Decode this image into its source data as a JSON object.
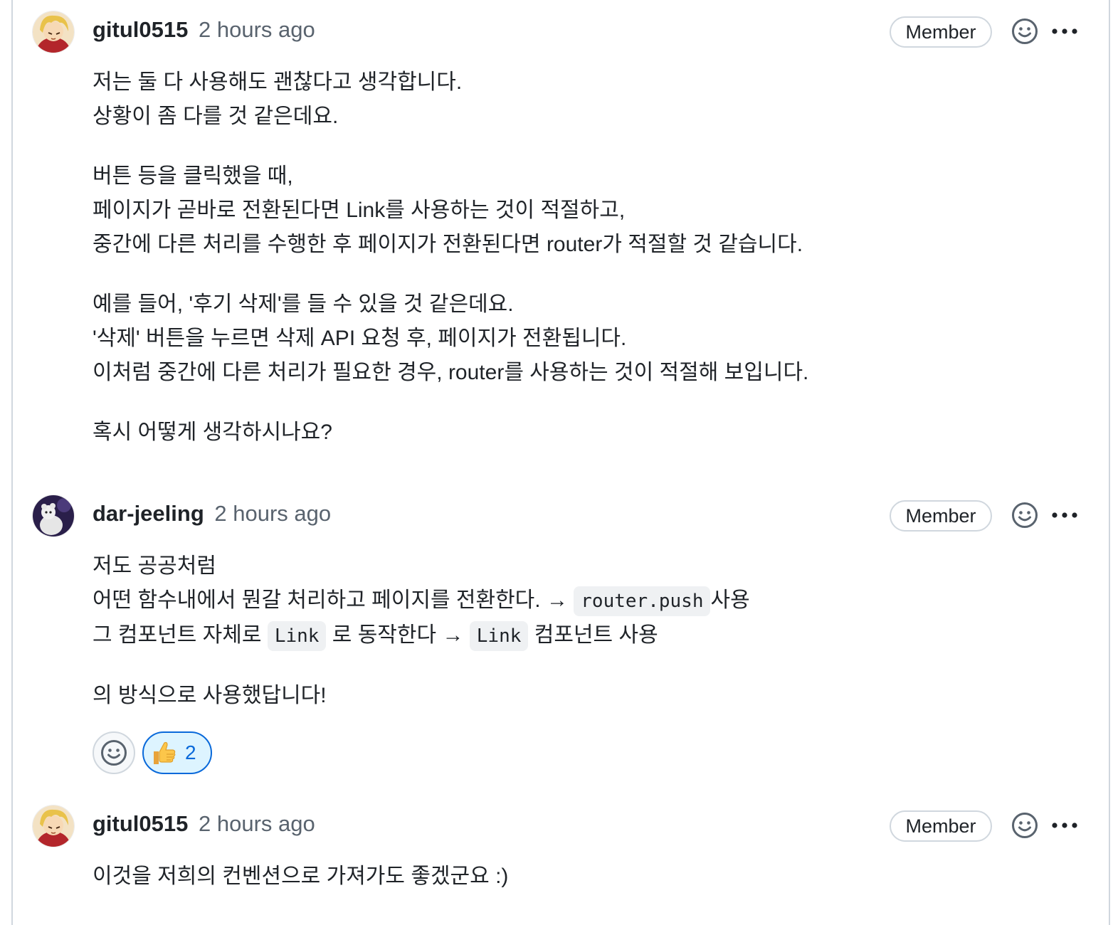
{
  "comments": [
    {
      "author": "gitul0515",
      "time": "2 hours ago",
      "badge": "Member",
      "lines": [
        "저는 둘 다 사용해도 괜찮다고 생각합니다.",
        "상황이 좀 다를 것 같은데요.",
        "버튼 등을 클릭했을 때,",
        "페이지가 곧바로 전환된다면 Link를 사용하는 것이 적절하고,",
        "중간에 다른 처리를 수행한 후 페이지가 전환된다면 router가 적절할 것 같습니다.",
        "예를 들어, '후기 삭제'를 들 수 있을 것 같은데요.",
        "'삭제' 버튼을 누르면 삭제 API 요청 후, 페이지가 전환됩니다.",
        "이처럼 중간에 다른 처리가 필요한 경우, router를 사용하는 것이 적절해 보입니다.",
        "혹시 어떻게 생각하시나요?"
      ]
    },
    {
      "author": "dar-jeeling",
      "time": "2 hours ago",
      "badge": "Member",
      "line1": "저도 공공처럼",
      "line2_text": "어떤 함수내에서 뭔갈 처리하고 페이지를 전환한다. → ",
      "line2_code": "router.push",
      "line2_suffix": "사용",
      "line3_text": "그 컴포넌트 자체로 ",
      "line3_code1": "Link",
      "line3_mid": " 로 동작한다 → ",
      "line3_code2": "Link",
      "line3_suffix": " 컴포넌트 사용",
      "line4": "의 방식으로 사용했답니다!",
      "reaction_count": "2"
    },
    {
      "author": "gitul0515",
      "time": "2 hours ago",
      "badge": "Member",
      "line1": "이것을 저희의 컨벤션으로 가져가도 좋겠군요 :)"
    }
  ],
  "icons": {
    "smiley": "smiley-icon",
    "more": "kebab-horizontal-icon",
    "thumbs_up": "thumbs-up-emoji"
  },
  "colors": {
    "accent": "#0969da",
    "reaction_bg": "#ddf4ff",
    "border": "#d0d7de",
    "muted_text": "#59636e"
  }
}
